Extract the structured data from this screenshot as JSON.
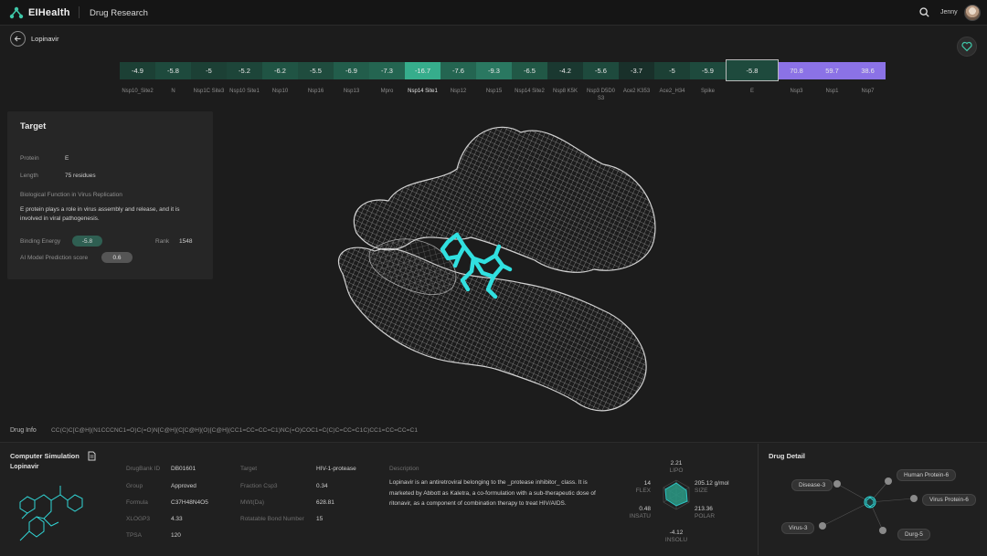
{
  "header": {
    "app_name": "EIHealth",
    "section": "Drug Research",
    "user_name": "Jenny"
  },
  "drug_name": "Lopinavir",
  "proteins": [
    {
      "value": "-4.9",
      "label": "Nsp10_Site2",
      "color": "#1c4035"
    },
    {
      "value": "-5.8",
      "label": "N",
      "color": "#1e4a3d"
    },
    {
      "value": "-5",
      "label": "Nsp1C Site3",
      "color": "#1c4035"
    },
    {
      "value": "-5.2",
      "label": "Nsp10 Site1",
      "color": "#1d4539"
    },
    {
      "value": "-6.2",
      "label": "Nsp10",
      "color": "#205444"
    },
    {
      "value": "-5.5",
      "label": "Nsp16",
      "color": "#1f4c3e"
    },
    {
      "value": "-6.9",
      "label": "Nsp13",
      "color": "#225d4b"
    },
    {
      "value": "-7.3",
      "label": "Mpro",
      "color": "#246551"
    },
    {
      "value": "-16.7",
      "label": "Nsp14 Site1",
      "color": "#36ad8c",
      "selected_label": true
    },
    {
      "value": "-7.6",
      "label": "Nsp12",
      "color": "#246551"
    },
    {
      "value": "-9.3",
      "label": "Nsp15",
      "color": "#2a7861"
    },
    {
      "value": "-6.5",
      "label": "Nsp14 Site2",
      "color": "#215846"
    },
    {
      "value": "-4.2",
      "label": "Nsp8 K5K",
      "color": "#1a3830"
    },
    {
      "value": "-5.6",
      "label": "Nsp3 D5D0 S3",
      "color": "#1e4a3d"
    },
    {
      "value": "-3.7",
      "label": "Ace2 K353",
      "color": "#19302a"
    },
    {
      "value": "-5",
      "label": "Ace2_H34",
      "color": "#1c4035"
    },
    {
      "value": "-5.9",
      "label": "Spike",
      "color": "#1e4a3d"
    },
    {
      "value": "-5.8",
      "label": "E",
      "color": "#1e4a3d",
      "selected": true
    },
    {
      "value": "70.8",
      "label": "Nsp3",
      "color": "#8b72e6"
    },
    {
      "value": "59.7",
      "label": "Nsp1",
      "color": "#8b72e6"
    },
    {
      "value": "38.6",
      "label": "Nsp7",
      "color": "#8b72e6"
    }
  ],
  "target": {
    "title": "Target",
    "protein_label": "Protein",
    "protein_value": "E",
    "length_label": "Length",
    "length_value": "75 residues",
    "function_label": "Biological Function in Virus Replication",
    "function_text": "E protein plays a role in virus assembly and release, and it is involved in viral pathogenesis.",
    "binding_energy_label": "Binding Energy",
    "binding_energy_value": "-5.8",
    "rank_label": "Rank",
    "rank_value": "1548",
    "ai_score_label": "AI Model Prediction score",
    "ai_score_value": "0.6"
  },
  "drug_info": {
    "label": "Drug Info",
    "smiles": "CC(C)C[C@H](N1CCCNC1=O)C(=O)N[C@H](C[C@H](O)[C@H](CC1=CC=CC=C1)NC(=O)COC1=C(C)C=CC=C1C)CC1=CC=CC=C1"
  },
  "simulation": {
    "title": "Computer Simulation",
    "subtitle": "Lopinavir",
    "props_col1": [
      {
        "label": "DrugBank ID",
        "value": "DB01601"
      },
      {
        "label": "Group",
        "value": "Approved"
      },
      {
        "label": "Formula",
        "value": "C37H48N4O5"
      },
      {
        "label": "XLOGP3",
        "value": "4.33"
      },
      {
        "label": "TPSA",
        "value": "120"
      }
    ],
    "props_col2": [
      {
        "label": "Target",
        "value": "HIV-1-protease"
      },
      {
        "label": "Fraction Csp3",
        "value": "0.34"
      },
      {
        "label": "MWt(Da)",
        "value": "628.81"
      },
      {
        "label": "Rotatable Bond Number",
        "value": "15"
      }
    ],
    "description_label": "Description",
    "description": "Lopinavir is an antiretroviral belonging to the _protease inhibitor_ class. It is marketed by Abbott as Kaletra, a co-formulation with a sub-therapeutic dose of ritonavir, as a component of combination therapy to treat HIV/AIDS."
  },
  "radar": {
    "lipo": {
      "value": "2.21",
      "key": "LIPO"
    },
    "size": {
      "value": "205.12 g/mol",
      "key": "SIZE"
    },
    "polar": {
      "value": "213.36",
      "key": "POLAR"
    },
    "insolu": {
      "value": "-4.12",
      "key": "INSOLU"
    },
    "insatu": {
      "value": "0.48",
      "key": "INSATU"
    },
    "flex": {
      "value": "14",
      "key": "FLEX"
    }
  },
  "drug_detail": {
    "title": "Drug Detail",
    "nodes": [
      "Disease-3",
      "Human Protein-6",
      "Virus Protein-6",
      "Virus-3",
      "Durg-5"
    ]
  },
  "colors": {
    "accent_teal": "#36ad8c",
    "ligand_cyan": "#31e0e0",
    "purple": "#8b72e6",
    "background": "#1c1c1c"
  }
}
